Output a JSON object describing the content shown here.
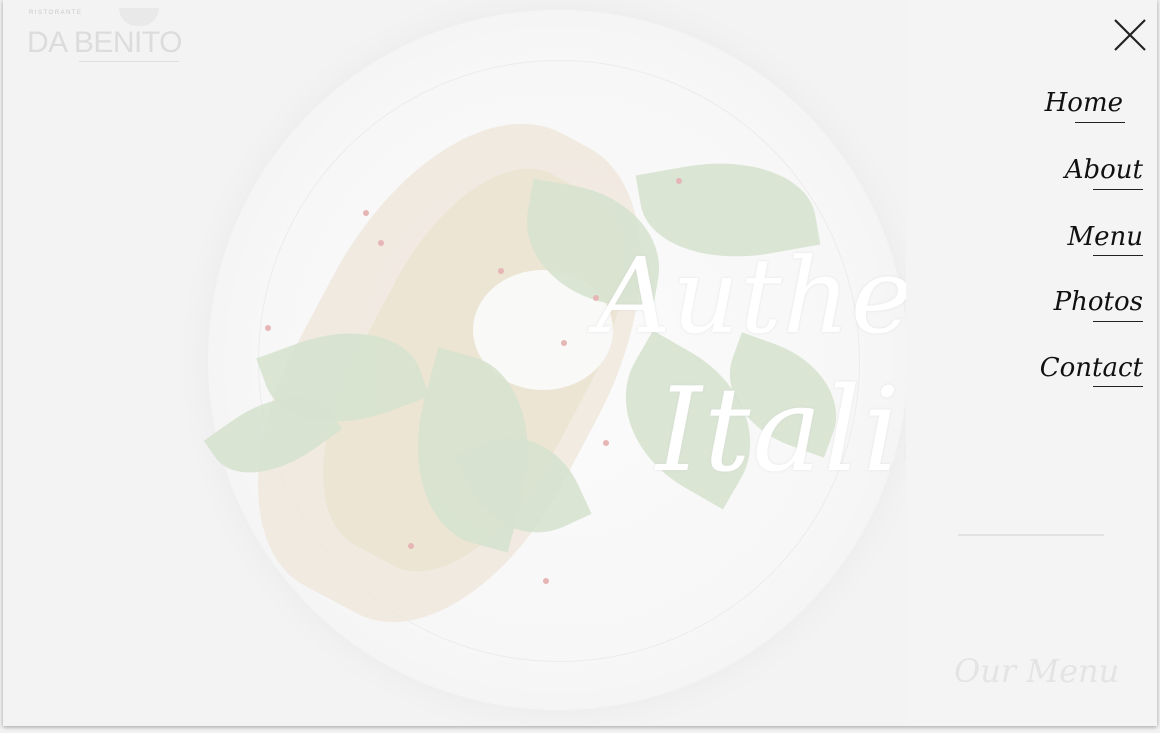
{
  "brand": {
    "tagline": "RISTORANTE",
    "name": "DA BENITO"
  },
  "hero": {
    "line1": "Authentic",
    "line2": "Italian"
  },
  "nav": {
    "items": [
      {
        "label": "Home"
      },
      {
        "label": "About"
      },
      {
        "label": "Menu"
      },
      {
        "label": "Photos"
      },
      {
        "label": "Contact"
      }
    ],
    "cta": "Our Menu"
  },
  "colors": {
    "panel_bg": "#f4f4f4",
    "nav_text": "#111111",
    "headline": "#ffffff"
  },
  "icons": {
    "close": "close-icon"
  }
}
